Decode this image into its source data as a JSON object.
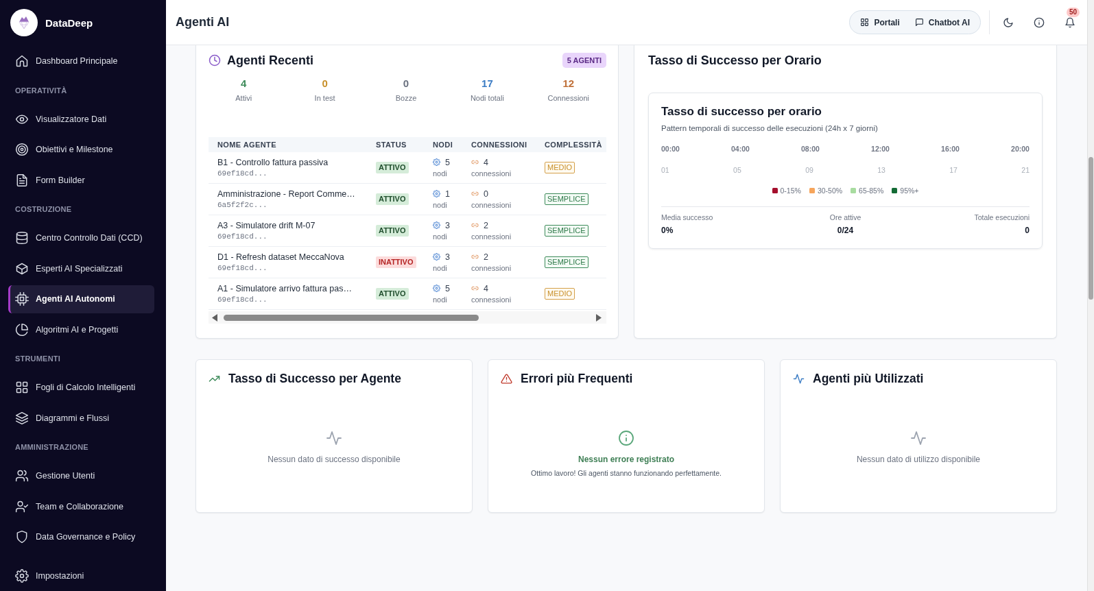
{
  "sidebar": {
    "brand": "DataDeep",
    "sections": [
      {
        "items": [
          {
            "label": "Dashboard Principale",
            "selected": false
          }
        ]
      },
      {
        "title": "OPERATIVITÀ",
        "items": [
          {
            "label": "Visualizzatore Dati",
            "selected": false
          },
          {
            "label": "Obiettivi e Milestone",
            "selected": false
          },
          {
            "label": "Form Builder",
            "selected": false
          }
        ]
      },
      {
        "title": "COSTRUZIONE",
        "items": [
          {
            "label": "Centro Controllo Dati (CCD)",
            "selected": false
          },
          {
            "label": "Esperti AI Specializzati",
            "selected": false
          },
          {
            "label": "Agenti AI Autonomi",
            "selected": true
          },
          {
            "label": "Algoritmi AI e Progetti",
            "selected": false
          }
        ]
      },
      {
        "title": "STRUMENTI",
        "items": [
          {
            "label": "Fogli di Calcolo Intelligenti",
            "selected": false
          },
          {
            "label": "Diagrammi e Flussi",
            "selected": false
          }
        ]
      },
      {
        "title": "AMMINISTRAZIONE",
        "items": [
          {
            "label": "Gestione Utenti",
            "selected": false
          },
          {
            "label": "Team e Collaborazione",
            "selected": false
          },
          {
            "label": "Data Governance e Policy",
            "selected": false
          }
        ]
      }
    ],
    "footer_item": {
      "label": "Impostazioni",
      "selected": false
    }
  },
  "topbar": {
    "title": "Agenti AI",
    "links": [
      "Portali",
      "Chatbot AI"
    ],
    "notification_count": "50"
  },
  "recent_agents": {
    "title": "Agenti Recenti",
    "badge": "5 AGENTI",
    "stats": [
      {
        "value": "4",
        "label": "Attivi",
        "color": "#3d8b5a"
      },
      {
        "value": "0",
        "label": "In test",
        "color": "#c8902a"
      },
      {
        "value": "0",
        "label": "Bozze",
        "color": "#6b7280"
      },
      {
        "value": "17",
        "label": "Nodi totali",
        "color": "#3b7cc4"
      },
      {
        "value": "12",
        "label": "Connessioni",
        "color": "#c0713a"
      }
    ],
    "table": {
      "columns": [
        "NOME AGENTE",
        "STATUS",
        "NODI",
        "CONNESSIONI",
        "COMPLESSITÀ"
      ],
      "rows": [
        {
          "name": "B1 - Controllo fattura passiva",
          "id": "69ef18cd...",
          "status": {
            "text": "ATTIVO",
            "kind": "active"
          },
          "nodes": "5",
          "nodes_unit": "nodi",
          "connections": "4",
          "connections_unit": "connessioni",
          "complexity": {
            "text": "MEDIO",
            "kind": "medium"
          }
        },
        {
          "name": "Amministrazione - Report Comme…",
          "id": "6a5f2f2c...",
          "status": {
            "text": "ATTIVO",
            "kind": "active"
          },
          "nodes": "1",
          "nodes_unit": "nodi",
          "connections": "0",
          "connections_unit": "connessioni",
          "complexity": {
            "text": "SEMPLICE",
            "kind": "simple"
          }
        },
        {
          "name": "A3 - Simulatore drift M-07",
          "id": "69ef18cd...",
          "status": {
            "text": "ATTIVO",
            "kind": "active"
          },
          "nodes": "3",
          "nodes_unit": "nodi",
          "connections": "2",
          "connections_unit": "connessioni",
          "complexity": {
            "text": "SEMPLICE",
            "kind": "simple"
          }
        },
        {
          "name": "D1 - Refresh dataset MeccaNova",
          "id": "69ef18cd...",
          "status": {
            "text": "INATTIVO",
            "kind": "inactive"
          },
          "nodes": "3",
          "nodes_unit": "nodi",
          "connections": "2",
          "connections_unit": "connessioni",
          "complexity": {
            "text": "SEMPLICE",
            "kind": "simple"
          }
        },
        {
          "name": "A1 - Simulatore arrivo fattura pas…",
          "id": "69ef18cd...",
          "status": {
            "text": "ATTIVO",
            "kind": "active"
          },
          "nodes": "5",
          "nodes_unit": "nodi",
          "connections": "4",
          "connections_unit": "connessioni",
          "complexity": {
            "text": "MEDIO",
            "kind": "medium"
          }
        }
      ]
    }
  },
  "hourly_success": {
    "title": "Tasso di Successo per Orario",
    "heatmap": {
      "title": "Tasso di successo per orario",
      "subtitle": "Pattern temporali di successo delle esecuzioni (24h x 7 giorni)",
      "hour_labels": [
        "00:00",
        "04:00",
        "08:00",
        "12:00",
        "16:00",
        "20:00"
      ],
      "hour_numbers": [
        "01",
        "05",
        "09",
        "13",
        "17",
        "21"
      ],
      "legend": [
        {
          "label": "0-15%",
          "color": "#a50f2d"
        },
        {
          "label": "30-50%",
          "color": "#f6a55c"
        },
        {
          "label": "65-85%",
          "color": "#a8dca0"
        },
        {
          "label": "95%+",
          "color": "#146b35"
        }
      ],
      "summary": [
        {
          "label": "Media successo",
          "value": "0%"
        },
        {
          "label": "Ore attive",
          "value": "0/24"
        },
        {
          "label": "Totale esecuzioni",
          "value": "0"
        }
      ]
    }
  },
  "panels": [
    {
      "title": "Tasso di Successo per Agente",
      "kind": "empty",
      "message": "Nessun dato di successo disponibile"
    },
    {
      "title": "Errori più Frequenti",
      "kind": "success",
      "message": "Nessun errore registrato",
      "detail": "Ottimo lavoro! Gli agenti stanno funzionando perfettamente."
    },
    {
      "title": "Agenti più Utilizzati",
      "kind": "empty",
      "message": "Nessun dato di utilizzo disponibile"
    }
  ]
}
